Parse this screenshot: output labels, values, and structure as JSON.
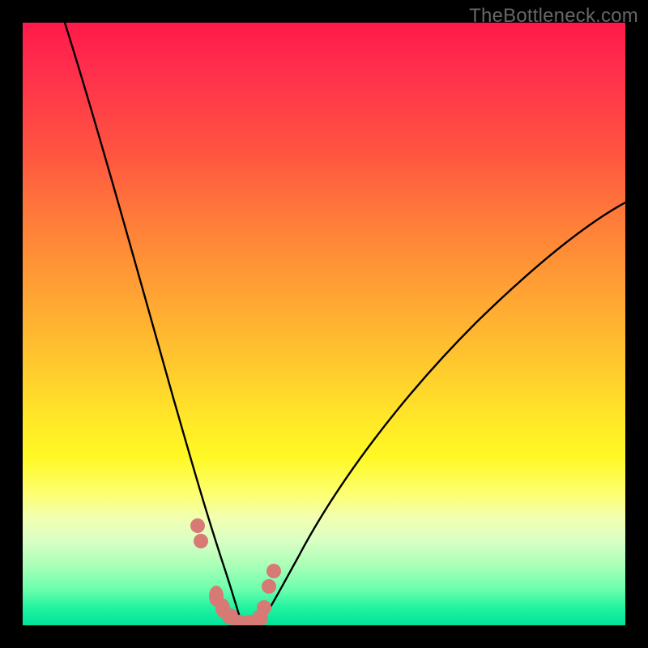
{
  "watermark": "TheBottleneck.com",
  "colors": {
    "background_frame": "#000000",
    "marker": "#d77a75",
    "curve": "#000000",
    "gradient_top": "#ff1a4a",
    "gradient_bottom": "#00e39a"
  },
  "chart_data": {
    "type": "line",
    "title": "",
    "xlabel": "",
    "ylabel": "",
    "xlim": [
      0,
      100
    ],
    "ylim": [
      0,
      100
    ],
    "note": "Bottleneck-style V curve. x = relative hardware balance (arbitrary), y = bottleneck percentage. Minimum near x≈36 where bottleneck ≈ 0. Left branch rises very steeply toward 100 as x→~7; right branch rises more gently toward ~70 as x→100.",
    "series": [
      {
        "name": "bottleneck-curve",
        "x": [
          7,
          10,
          14,
          18,
          22,
          26,
          29,
          31,
          33,
          35,
          36,
          38,
          40,
          43,
          48,
          55,
          63,
          72,
          82,
          92,
          100
        ],
        "y": [
          100,
          84,
          66,
          50,
          36,
          24,
          15,
          9,
          4,
          1,
          0,
          1,
          3,
          7,
          14,
          23,
          32,
          42,
          52,
          62,
          70
        ]
      }
    ],
    "markers": {
      "name": "highlighted-points-near-minimum",
      "x": [
        29.0,
        29.6,
        32.0,
        33.0,
        34.0,
        35.5,
        37.0,
        38.5,
        40.0,
        40.8,
        41.6
      ],
      "y": [
        16.5,
        14.0,
        3.8,
        2.5,
        1.4,
        0.6,
        0.6,
        1.2,
        3.0,
        6.5,
        9.0
      ]
    }
  }
}
